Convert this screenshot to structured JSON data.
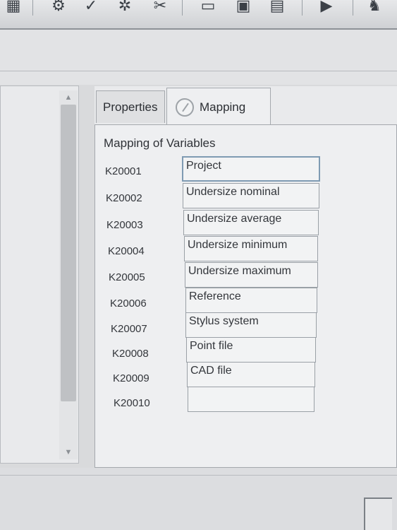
{
  "toolbar": {
    "icons": [
      "grid-icon",
      "gear-icon",
      "check-icon",
      "tool-icon",
      "wrench-icon",
      "print-icon",
      "save-icon",
      "document-icon",
      "run-icon",
      "probe-icon"
    ]
  },
  "tabs": {
    "properties": "Properties",
    "mapping": "Mapping"
  },
  "mapping": {
    "title": "Mapping of Variables",
    "rows": [
      {
        "variable": "K20001",
        "value": "Project"
      },
      {
        "variable": "K20002",
        "value": "Undersize nominal"
      },
      {
        "variable": "K20003",
        "value": "Undersize average"
      },
      {
        "variable": "K20004",
        "value": "Undersize minimum"
      },
      {
        "variable": "K20005",
        "value": "Undersize maximum"
      },
      {
        "variable": "K20006",
        "value": "Reference"
      },
      {
        "variable": "K20007",
        "value": "Stylus system"
      },
      {
        "variable": "K20008",
        "value": "Point file"
      },
      {
        "variable": "K20009",
        "value": "CAD file"
      },
      {
        "variable": "K20010",
        "value": ""
      }
    ]
  }
}
